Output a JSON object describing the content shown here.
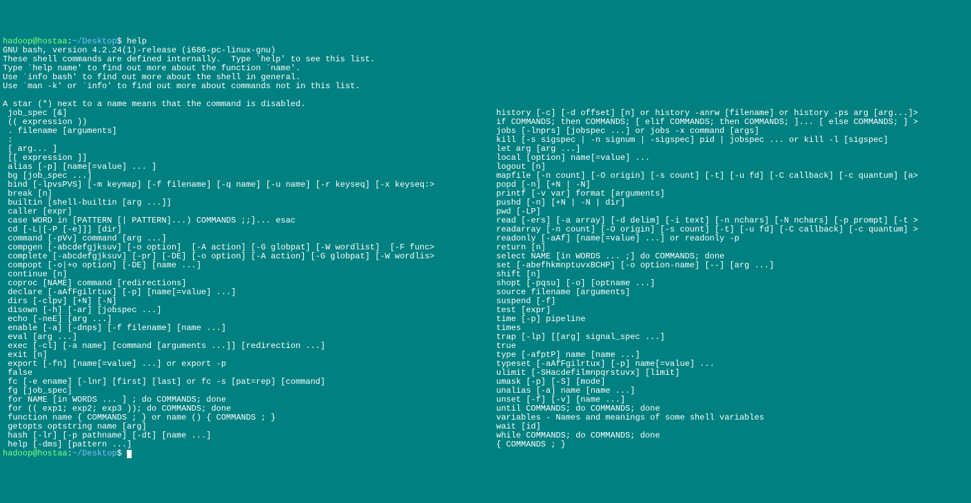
{
  "prompt1": {
    "user": "hadoop@hostaa",
    "sep": ":",
    "path": "~/Desktop",
    "dollar": "$ ",
    "cmd": "help"
  },
  "header": [
    "GNU bash, version 4.2.24(1)-release (i686-pc-linux-gnu)",
    "These shell commands are defined internally.  Type `help' to see this list.",
    "Type `help name' to find out more about the function `name'.",
    "Use `info bash' to find out more about the shell in general.",
    "Use `man -k' or `info' to find out more about commands not in this list.",
    "",
    "A star (*) next to a name means that the command is disabled.",
    ""
  ],
  "left": [
    " job_spec [&]",
    " (( expression ))",
    " . filename [arguments]",
    " :",
    " [ arg... ]",
    " [[ expression ]]",
    " alias [-p] [name[=value] ... ]",
    " bg [job_spec ...]",
    " bind [-lpvsPVS] [-m keymap] [-f filename] [-q name] [-u name] [-r keyseq] [-x keyseq:>",
    " break [n]",
    " builtin [shell-builtin [arg ...]]",
    " caller [expr]",
    " case WORD in [PATTERN [| PATTERN]...) COMMANDS ;;]... esac",
    " cd [-L|[-P [-e]]] [dir]",
    " command [-pVv] command [arg ...]",
    " compgen [-abcdefgjksuv] [-o option]  [-A action] [-G globpat] [-W wordlist]  [-F func>",
    " complete [-abcdefgjksuv] [-pr] [-DE] [-o option] [-A action] [-G globpat] [-W wordlis>",
    " compopt [-o|+o option] [-DE] [name ...]",
    " continue [n]",
    " coproc [NAME] command [redirections]",
    " declare [-aAfFgilrtux] [-p] [name[=value] ...]",
    " dirs [-clpv] [+N] [-N]",
    " disown [-h] [-ar] [jobspec ...]",
    " echo [-neE] [arg ...]",
    " enable [-a] [-dnps] [-f filename] [name ...]",
    " eval [arg ...]",
    " exec [-cl] [-a name] [command [arguments ...]] [redirection ...]",
    " exit [n]",
    " export [-fn] [name[=value] ...] or export -p",
    " false",
    " fc [-e ename] [-lnr] [first] [last] or fc -s [pat=rep] [command]",
    " fg [job_spec]",
    " for NAME [in WORDS ... ] ; do COMMANDS; done",
    " for (( exp1; exp2; exp3 )); do COMMANDS; done",
    " function name { COMMANDS ; } or name () { COMMANDS ; }",
    " getopts optstring name [arg]",
    " hash [-lr] [-p pathname] [-dt] [name ...]",
    " help [-dms] [pattern ...]"
  ],
  "right": [
    "history [-c] [-d offset] [n] or history -anrw [filename] or history -ps arg [arg...]>",
    "if COMMANDS; then COMMANDS; [ elif COMMANDS; then COMMANDS; ]... [ else COMMANDS; ] >",
    "jobs [-lnprs] [jobspec ...] or jobs -x command [args]",
    "kill [-s sigspec | -n signum | -sigspec] pid | jobspec ... or kill -l [sigspec]",
    "let arg [arg ...]",
    "local [option] name[=value] ...",
    "logout [n]",
    "mapfile [-n count] [-O origin] [-s count] [-t] [-u fd] [-C callback] [-c quantum] [a>",
    "popd [-n] [+N | -N]",
    "printf [-v var] format [arguments]",
    "pushd [-n] [+N | -N | dir]",
    "pwd [-LP]",
    "read [-ers] [-a array] [-d delim] [-i text] [-n nchars] [-N nchars] [-p prompt] [-t >",
    "readarray [-n count] [-O origin] [-s count] [-t] [-u fd] [-C callback] [-c quantum] >",
    "readonly [-aAf] [name[=value] ...] or readonly -p",
    "return [n]",
    "select NAME [in WORDS ... ;] do COMMANDS; done",
    "set [-abefhkmnptuvxBCHP] [-o option-name] [--] [arg ...]",
    "shift [n]",
    "shopt [-pqsu] [-o] [optname ...]",
    "source filename [arguments]",
    "suspend [-f]",
    "test [expr]",
    "time [-p] pipeline",
    "times",
    "trap [-lp] [[arg] signal_spec ...]",
    "true",
    "type [-afptP] name [name ...]",
    "typeset [-aAfFgilrtux] [-p] name[=value] ...",
    "ulimit [-SHacdefilmnpqrstuvx] [limit]",
    "umask [-p] [-S] [mode]",
    "unalias [-a] name [name ...]",
    "unset [-f] [-v] [name ...]",
    "until COMMANDS; do COMMANDS; done",
    "variables - Names and meanings of some shell variables",
    "wait [id]",
    "while COMMANDS; do COMMANDS; done",
    "{ COMMANDS ; }"
  ],
  "prompt2": {
    "user": "hadoop@hostaa",
    "sep": ":",
    "path": "~/Desktop",
    "dollar": "$ "
  }
}
